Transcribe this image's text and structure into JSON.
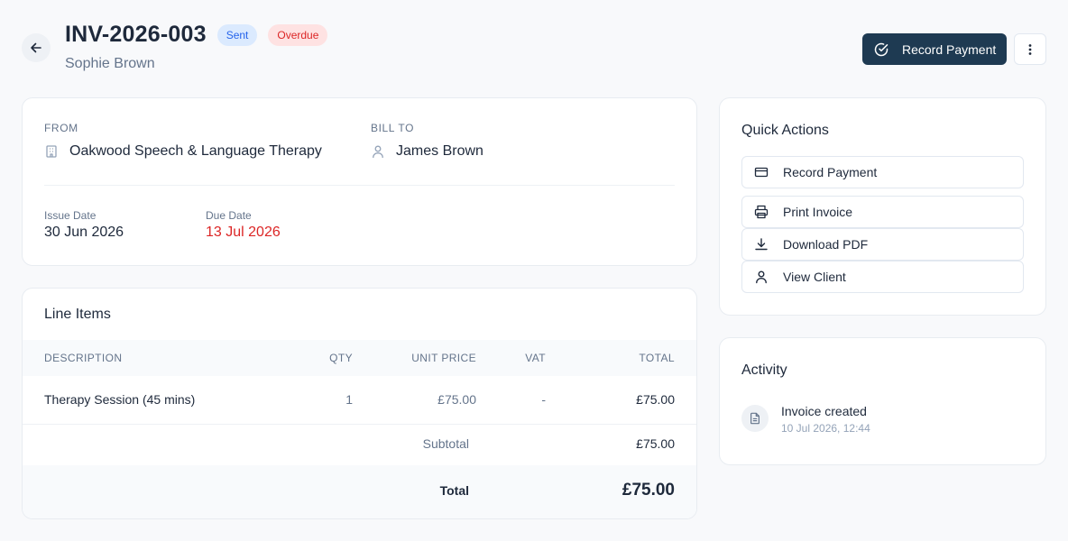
{
  "header": {
    "invoice_number": "INV-2026-003",
    "status_badges": [
      "Sent",
      "Overdue"
    ],
    "client_name": "Sophie Brown",
    "primary_action": "Record Payment"
  },
  "details": {
    "from_label": "FROM",
    "from_name": "Oakwood Speech & Language Therapy",
    "bill_to_label": "BILL TO",
    "bill_to_name": "James Brown",
    "issue_date_label": "Issue Date",
    "issue_date": "30 Jun 2026",
    "due_date_label": "Due Date",
    "due_date": "13 Jul 2026"
  },
  "line_items": {
    "heading": "Line Items",
    "columns": [
      "DESCRIPTION",
      "QTY",
      "UNIT PRICE",
      "VAT",
      "TOTAL"
    ],
    "rows": [
      {
        "description": "Therapy Session (45 mins)",
        "qty": "1",
        "unit_price": "£75.00",
        "vat": "-",
        "total": "£75.00"
      }
    ],
    "subtotal_label": "Subtotal",
    "subtotal": "£75.00",
    "total_label": "Total",
    "total": "£75.00"
  },
  "quick_actions": {
    "heading": "Quick Actions",
    "items": [
      {
        "label": "Record Payment",
        "icon": "credit-card-icon"
      },
      {
        "label": "Print Invoice",
        "icon": "printer-icon"
      },
      {
        "label": "Download PDF",
        "icon": "download-icon"
      },
      {
        "label": "View Client",
        "icon": "user-icon"
      }
    ]
  },
  "activity": {
    "heading": "Activity",
    "items": [
      {
        "title": "Invoice created",
        "time": "10 Jul 2026, 12:44",
        "icon": "document-icon"
      }
    ]
  },
  "colors": {
    "primary": "#1e3a52",
    "overdue": "#dc2626",
    "sent": "#2563eb"
  }
}
